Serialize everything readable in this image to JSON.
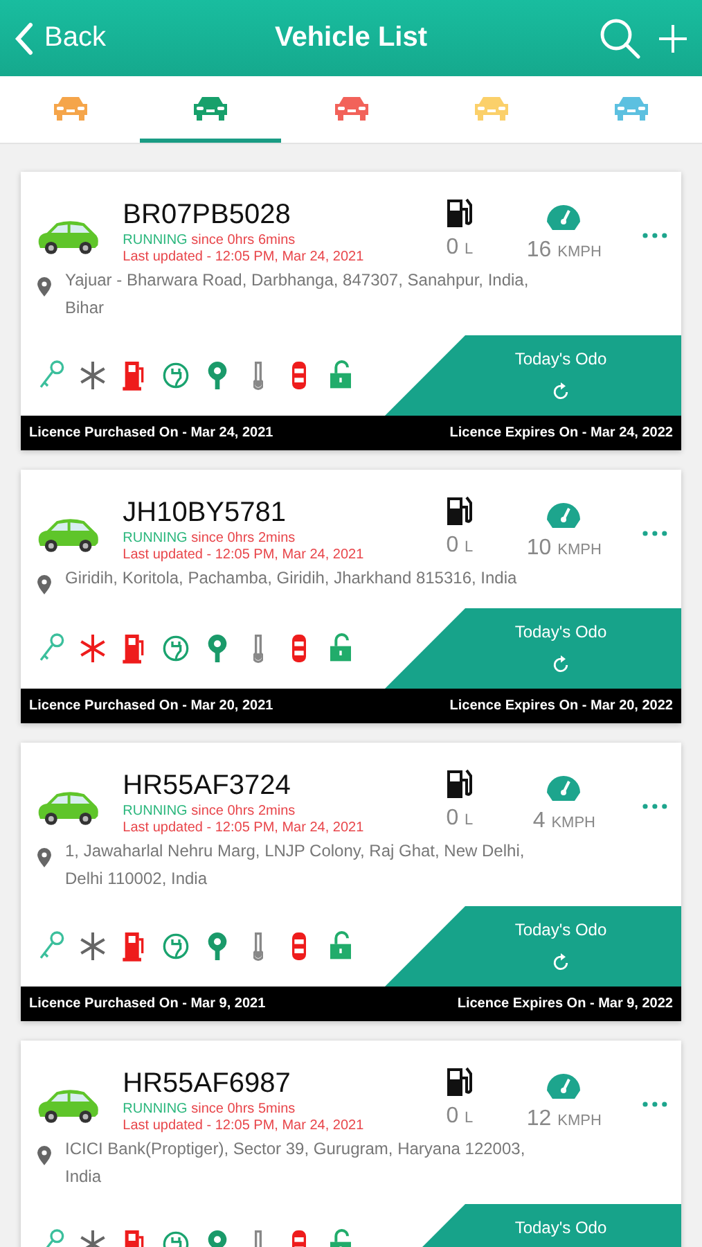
{
  "header": {
    "back": "Back",
    "title": "Vehicle List"
  },
  "tabs": [
    {
      "color": "#f5a54a",
      "selected": false
    },
    {
      "color": "#17a06b",
      "selected": true
    },
    {
      "color": "#f2625a",
      "selected": false
    },
    {
      "color": "#fbd06a",
      "selected": false
    },
    {
      "color": "#5cc0e0",
      "selected": false
    }
  ],
  "vehicles": [
    {
      "plate": "BR07PB5028",
      "state": "RUNNING",
      "since": "since 0hrs 6mins",
      "updated": "Last updated - 12:05 PM, Mar 24, 2021",
      "fuel": "0",
      "fuel_unit": "L",
      "speed": "16",
      "speed_unit": "KMPH",
      "address": "Yajuar - Bharwara Road, Darbhanga, 847307, Sanahpur, India, Bihar",
      "status_icons": [
        {
          "kind": "key",
          "color": "#3bbf9c"
        },
        {
          "kind": "snow",
          "color": "#666666"
        },
        {
          "kind": "fuel",
          "color": "#ee1c1c"
        },
        {
          "kind": "plug",
          "color": "#1aa36f"
        },
        {
          "kind": "pin",
          "color": "#1a9a6a"
        },
        {
          "kind": "thermo",
          "color": "#888888"
        },
        {
          "kind": "door",
          "color": "#ee1c1c"
        },
        {
          "kind": "lock",
          "color": "#21ac6b"
        }
      ],
      "odo": "Today's Odo",
      "purchased": "Licence Purchased On - Mar 24, 2021",
      "expires": "Licence Expires On - Mar 24, 2022"
    },
    {
      "plate": "JH10BY5781",
      "state": "RUNNING",
      "since": "since 0hrs 2mins",
      "updated": "Last updated - 12:05 PM, Mar 24, 2021",
      "fuel": "0",
      "fuel_unit": "L",
      "speed": "10",
      "speed_unit": "KMPH",
      "address": "Giridih, Koritola, Pachamba, Giridih, Jharkhand 815316, India",
      "status_icons": [
        {
          "kind": "key",
          "color": "#3bbf9c"
        },
        {
          "kind": "snow",
          "color": "#ee1c1c"
        },
        {
          "kind": "fuel",
          "color": "#ee1c1c"
        },
        {
          "kind": "plug",
          "color": "#1aa36f"
        },
        {
          "kind": "pin",
          "color": "#1a9a6a"
        },
        {
          "kind": "thermo",
          "color": "#888888"
        },
        {
          "kind": "door",
          "color": "#ee1c1c"
        },
        {
          "kind": "lock",
          "color": "#21ac6b"
        }
      ],
      "odo": "Today's Odo",
      "purchased": "Licence Purchased On - Mar 20, 2021",
      "expires": "Licence Expires On - Mar 20, 2022"
    },
    {
      "plate": "HR55AF3724",
      "state": "RUNNING",
      "since": "since 0hrs 2mins",
      "updated": "Last updated - 12:05 PM, Mar 24, 2021",
      "fuel": "0",
      "fuel_unit": "L",
      "speed": "4",
      "speed_unit": "KMPH",
      "address": "1, Jawaharlal Nehru Marg, LNJP Colony, Raj Ghat, New Delhi, Delhi 110002, India",
      "status_icons": [
        {
          "kind": "key",
          "color": "#3bbf9c"
        },
        {
          "kind": "snow",
          "color": "#666666"
        },
        {
          "kind": "fuel",
          "color": "#ee1c1c"
        },
        {
          "kind": "plug",
          "color": "#1aa36f"
        },
        {
          "kind": "pin",
          "color": "#1a9a6a"
        },
        {
          "kind": "thermo",
          "color": "#888888"
        },
        {
          "kind": "door",
          "color": "#ee1c1c"
        },
        {
          "kind": "lock",
          "color": "#21ac6b"
        }
      ],
      "odo": "Today's Odo",
      "purchased": "Licence Purchased On - Mar 9, 2021",
      "expires": "Licence Expires On - Mar 9, 2022"
    },
    {
      "plate": "HR55AF6987",
      "state": "RUNNING",
      "since": "since 0hrs 5mins",
      "updated": "Last updated - 12:05 PM, Mar 24, 2021",
      "fuel": "0",
      "fuel_unit": "L",
      "speed": "12",
      "speed_unit": "KMPH",
      "address": "ICICI Bank(Proptiger), Sector 39, Gurugram, Haryana 122003, India",
      "status_icons": [
        {
          "kind": "key",
          "color": "#3bbf9c"
        },
        {
          "kind": "snow",
          "color": "#666666"
        },
        {
          "kind": "fuel",
          "color": "#ee1c1c"
        },
        {
          "kind": "plug",
          "color": "#1aa36f"
        },
        {
          "kind": "pin",
          "color": "#1a9a6a"
        },
        {
          "kind": "thermo",
          "color": "#888888"
        },
        {
          "kind": "door",
          "color": "#ee1c1c"
        },
        {
          "kind": "lock",
          "color": "#21ac6b"
        }
      ],
      "odo": "Today's Odo"
    }
  ]
}
